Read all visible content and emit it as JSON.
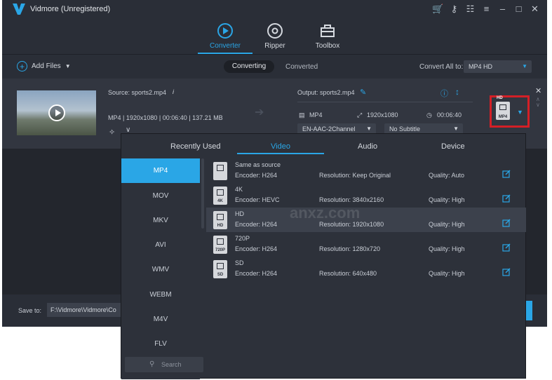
{
  "app": {
    "title": "Vidmore (Unregistered)",
    "accent_color": "#2aa6e6",
    "window_icons": [
      "cart-icon",
      "key-icon",
      "chat-icon",
      "menu-icon",
      "minimize-icon",
      "maximize-icon",
      "close-icon"
    ]
  },
  "modes": [
    {
      "label": "Converter",
      "icon": "converter-icon",
      "active": true
    },
    {
      "label": "Ripper",
      "icon": "ripper-icon",
      "active": false
    },
    {
      "label": "Toolbox",
      "icon": "toolbox-icon",
      "active": false
    }
  ],
  "toolbar": {
    "add_files": "Add Files",
    "tab_converting": "Converting",
    "tab_converted": "Converted",
    "convert_all_label": "Convert All to:",
    "convert_all_value": "MP4 HD"
  },
  "file": {
    "source": "Source: sports2.mp4",
    "meta": "MP4 | 1920x1080 | 00:06:40 | 137.21 MB",
    "output": "Output: sports2.mp4",
    "out_format": "MP4",
    "out_resolution": "1920x1080",
    "out_duration": "00:06:40",
    "audio_track": "EN-AAC-2Channel",
    "subtitle": "No Subtitle",
    "format_badge": "HD",
    "format_badge_sub": "MP4"
  },
  "bottom": {
    "save_to_label": "Save to:",
    "save_path": "F:\\Vidmore\\Vidmore\\Co"
  },
  "popup": {
    "tabs": [
      "Recently Used",
      "Video",
      "Audio",
      "Device"
    ],
    "active_tab": "Video",
    "formats": [
      "MP4",
      "MOV",
      "MKV",
      "AVI",
      "WMV",
      "WEBM",
      "M4V",
      "FLV"
    ],
    "active_format": "MP4",
    "search_placeholder": "Search",
    "presets": [
      {
        "name": "Same as source",
        "badge": "",
        "encoder": "Encoder: H264",
        "resolution": "Resolution: Keep Original",
        "quality": "Quality: Auto"
      },
      {
        "name": "4K",
        "badge": "4K",
        "encoder": "Encoder: HEVC",
        "resolution": "Resolution: 3840x2160",
        "quality": "Quality: High"
      },
      {
        "name": "HD",
        "badge": "HD",
        "encoder": "Encoder: H264",
        "resolution": "Resolution: 1920x1080",
        "quality": "Quality: High"
      },
      {
        "name": "720P",
        "badge": "720P",
        "encoder": "Encoder: H264",
        "resolution": "Resolution: 1280x720",
        "quality": "Quality: High"
      },
      {
        "name": "SD",
        "badge": "SD",
        "encoder": "Encoder: H264",
        "resolution": "Resolution: 640x480",
        "quality": "Quality: High"
      }
    ],
    "selected_preset": "HD"
  },
  "watermark": {
    "text": "anxz.com"
  }
}
